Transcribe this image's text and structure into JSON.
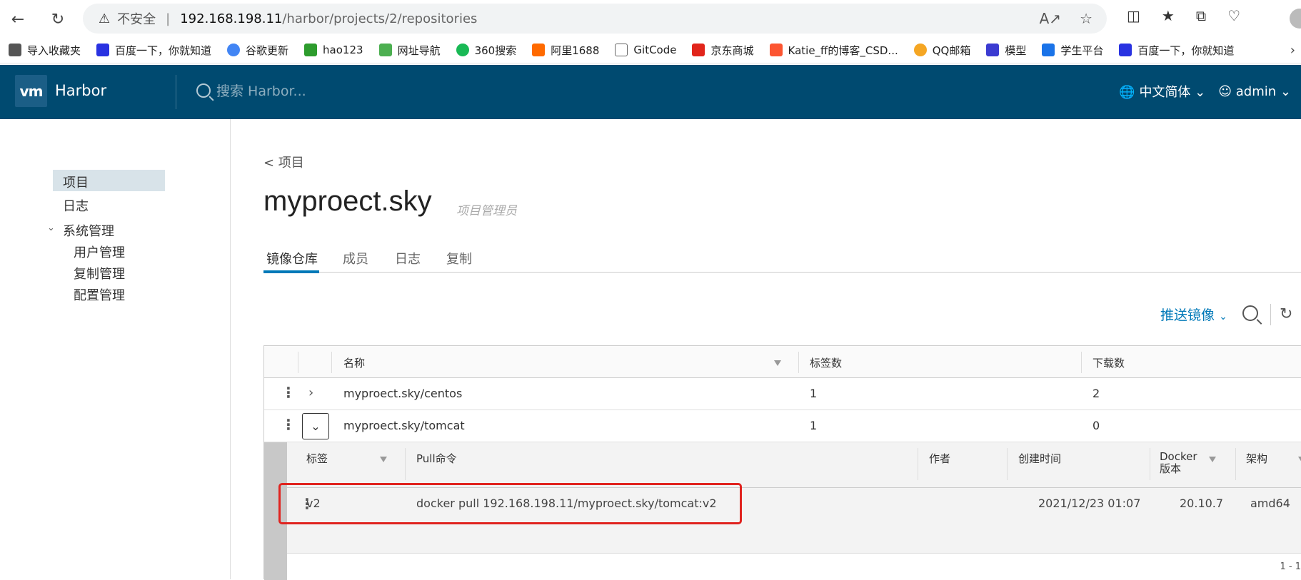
{
  "browser": {
    "insecure_label": "不安全",
    "url_host": "192.168.198.11",
    "url_path": "/harbor/projects/2/repositories",
    "bookmarks": [
      {
        "label": "导入收藏夹",
        "color": "#555555"
      },
      {
        "label": "百度一下，你就知道",
        "color": "#2932e1"
      },
      {
        "label": "谷歌更新",
        "color": "#4285f4"
      },
      {
        "label": "hao123",
        "color": "#2d9c2d"
      },
      {
        "label": "网址导航",
        "color": "#4caf50"
      },
      {
        "label": "360搜索",
        "color": "#19b955"
      },
      {
        "label": "阿里1688",
        "color": "#ff6a00"
      },
      {
        "label": "GitCode",
        "color": "#666666"
      },
      {
        "label": "京东商城",
        "color": "#e1251b"
      },
      {
        "label": "Katie_ff的博客_CSD...",
        "color": "#fc5531"
      },
      {
        "label": "QQ邮箱",
        "color": "#f5a623"
      },
      {
        "label": "模型",
        "color": "#3b3bd1"
      },
      {
        "label": "学生平台",
        "color": "#1a73e8"
      },
      {
        "label": "百度一下，你就知道",
        "color": "#2932e1"
      }
    ]
  },
  "header": {
    "logo_text": "vm",
    "title": "Harbor",
    "search_placeholder": "搜索 Harbor...",
    "language": "中文简体",
    "user": "admin",
    "bg_color": "#004a70"
  },
  "sidebar": {
    "items": [
      {
        "label": "项目"
      },
      {
        "label": "日志"
      },
      {
        "label": "系统管理"
      },
      {
        "label": "用户管理"
      },
      {
        "label": "复制管理"
      },
      {
        "label": "配置管理"
      }
    ]
  },
  "main": {
    "back_label": "< 项目",
    "project_name": "myproect.sky",
    "role": "项目管理员",
    "tabs": [
      {
        "label": "镜像仓库"
      },
      {
        "label": "成员"
      },
      {
        "label": "日志"
      },
      {
        "label": "复制"
      }
    ],
    "push_label": "推送镜像",
    "accent_color": "#0079b8"
  },
  "repo_table": {
    "columns": {
      "name": "名称",
      "tags": "标签数",
      "pulls": "下载数"
    },
    "rows": [
      {
        "name": "myproect.sky/centos",
        "tags": "1",
        "pulls": "2"
      },
      {
        "name": "myproect.sky/tomcat",
        "tags": "1",
        "pulls": "0"
      }
    ]
  },
  "tag_table": {
    "columns": {
      "tag": "标签",
      "pull": "Pull命令",
      "author": "作者",
      "created": "创建时间",
      "docker": "Docker\n版本",
      "arch": "架构"
    },
    "rows": [
      {
        "tag": "v2",
        "pull": "docker pull 192.168.198.11/myproect.sky/tomcat:v2",
        "author": "",
        "created": "2021/12/23 01:07",
        "docker": "20.10.7",
        "arch": "amd64"
      }
    ],
    "pager": "1 - 1"
  }
}
